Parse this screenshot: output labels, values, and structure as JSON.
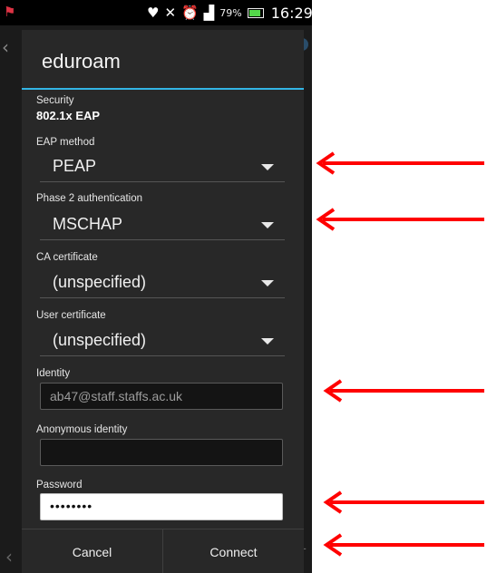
{
  "status_bar": {
    "battery_percent": "79%",
    "time": "16:29",
    "icons": [
      "flag-icon",
      "heart-shield-icon",
      "mute-icon",
      "alarm-icon",
      "signal-icon",
      "battery-icon"
    ]
  },
  "dialog": {
    "title": "eduroam",
    "security_label": "Security",
    "security_value": "802.1x EAP",
    "eap_method": {
      "label": "EAP method",
      "value": "PEAP"
    },
    "phase2": {
      "label": "Phase 2 authentication",
      "value": "MSCHAP"
    },
    "ca_cert": {
      "label": "CA certificate",
      "value": "(unspecified)"
    },
    "user_cert": {
      "label": "User certificate",
      "value": "(unspecified)"
    },
    "identity": {
      "label": "Identity",
      "value": "ab47@staff.staffs.ac.uk"
    },
    "anon_identity": {
      "label": "Anonymous identity",
      "value": ""
    },
    "password": {
      "label": "Password",
      "value": "••••••••"
    },
    "buttons": {
      "cancel": "Cancel",
      "connect": "Connect"
    }
  },
  "annotations": {
    "arrow_color": "#ff0000",
    "arrows": [
      "eap-method",
      "phase2-authentication",
      "identity",
      "password",
      "connect"
    ]
  },
  "colors": {
    "accent": "#33b5e5",
    "dialog_bg": "#282828"
  }
}
